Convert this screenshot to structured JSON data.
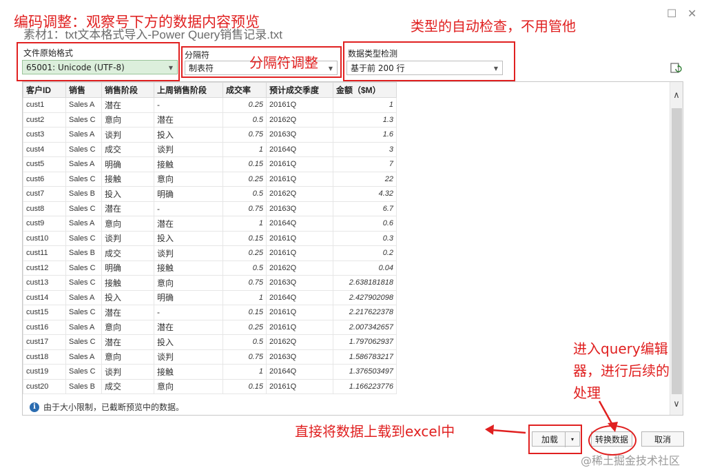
{
  "window": {
    "title": "素材1：txt文本格式导入-Power Query销售记录.txt",
    "restore_glyph": "☐",
    "close_glyph": "✕"
  },
  "controls": {
    "file_origin_label": "文件原始格式",
    "file_origin_value": "65001: Unicode (UTF-8)",
    "delimiter_label": "分隔符",
    "delimiter_value": "制表符",
    "detect_label": "数据类型检测",
    "detect_value": "基于前 200 行"
  },
  "table": {
    "headers": [
      "客户ID",
      "销售",
      "销售阶段",
      "上周销售阶段",
      "成交率",
      "预计成交季度",
      "金额（$M）"
    ],
    "rows": [
      [
        "cust1",
        "Sales A",
        "潜在",
        "-",
        "0.25",
        "20161Q",
        "1"
      ],
      [
        "cust2",
        "Sales C",
        "意向",
        "潜在",
        "0.5",
        "20162Q",
        "1.3"
      ],
      [
        "cust3",
        "Sales A",
        "谈判",
        "投入",
        "0.75",
        "20163Q",
        "1.6"
      ],
      [
        "cust4",
        "Sales C",
        "成交",
        "谈判",
        "1",
        "20164Q",
        "3"
      ],
      [
        "cust5",
        "Sales A",
        "明确",
        "接触",
        "0.15",
        "20161Q",
        "7"
      ],
      [
        "cust6",
        "Sales C",
        "接触",
        "意向",
        "0.25",
        "20161Q",
        "22"
      ],
      [
        "cust7",
        "Sales B",
        "投入",
        "明确",
        "0.5",
        "20162Q",
        "4.32"
      ],
      [
        "cust8",
        "Sales C",
        "潜在",
        "-",
        "0.75",
        "20163Q",
        "6.7"
      ],
      [
        "cust9",
        "Sales A",
        "意向",
        "潜在",
        "1",
        "20164Q",
        "0.6"
      ],
      [
        "cust10",
        "Sales C",
        "谈判",
        "投入",
        "0.15",
        "20161Q",
        "0.3"
      ],
      [
        "cust11",
        "Sales B",
        "成交",
        "谈判",
        "0.25",
        "20161Q",
        "0.2"
      ],
      [
        "cust12",
        "Sales C",
        "明确",
        "接触",
        "0.5",
        "20162Q",
        "0.04"
      ],
      [
        "cust13",
        "Sales C",
        "接触",
        "意向",
        "0.75",
        "20163Q",
        "2.638181818"
      ],
      [
        "cust14",
        "Sales A",
        "投入",
        "明确",
        "1",
        "20164Q",
        "2.427902098"
      ],
      [
        "cust15",
        "Sales C",
        "潜在",
        "-",
        "0.15",
        "20161Q",
        "2.217622378"
      ],
      [
        "cust16",
        "Sales A",
        "意向",
        "潜在",
        "0.25",
        "20161Q",
        "2.007342657"
      ],
      [
        "cust17",
        "Sales C",
        "潜在",
        "投入",
        "0.5",
        "20162Q",
        "1.797062937"
      ],
      [
        "cust18",
        "Sales A",
        "意向",
        "谈判",
        "0.75",
        "20163Q",
        "1.586783217"
      ],
      [
        "cust19",
        "Sales C",
        "谈判",
        "接触",
        "1",
        "20164Q",
        "1.376503497"
      ],
      [
        "cust20",
        "Sales B",
        "成交",
        "意向",
        "0.15",
        "20161Q",
        "1.166223776"
      ]
    ]
  },
  "info": {
    "icon_glyph": "i",
    "text": "由于大小限制，已截断预览中的数据。"
  },
  "buttons": {
    "load": "加载",
    "transform": "转换数据",
    "cancel": "取消",
    "dropdown_glyph": "▾"
  },
  "annotations": {
    "encoding": "编码调整：观察号下方的数据内容预览",
    "types": "类型的自动检查，不用管他",
    "delimiter": "分隔符调整",
    "query_line1": "进入query编辑",
    "query_line2": "器，进行后续的",
    "query_line3": "处理",
    "load_excel": "直接将数据上载到excel中",
    "color": "#e02020"
  },
  "watermark": "@稀土掘金技术社区"
}
